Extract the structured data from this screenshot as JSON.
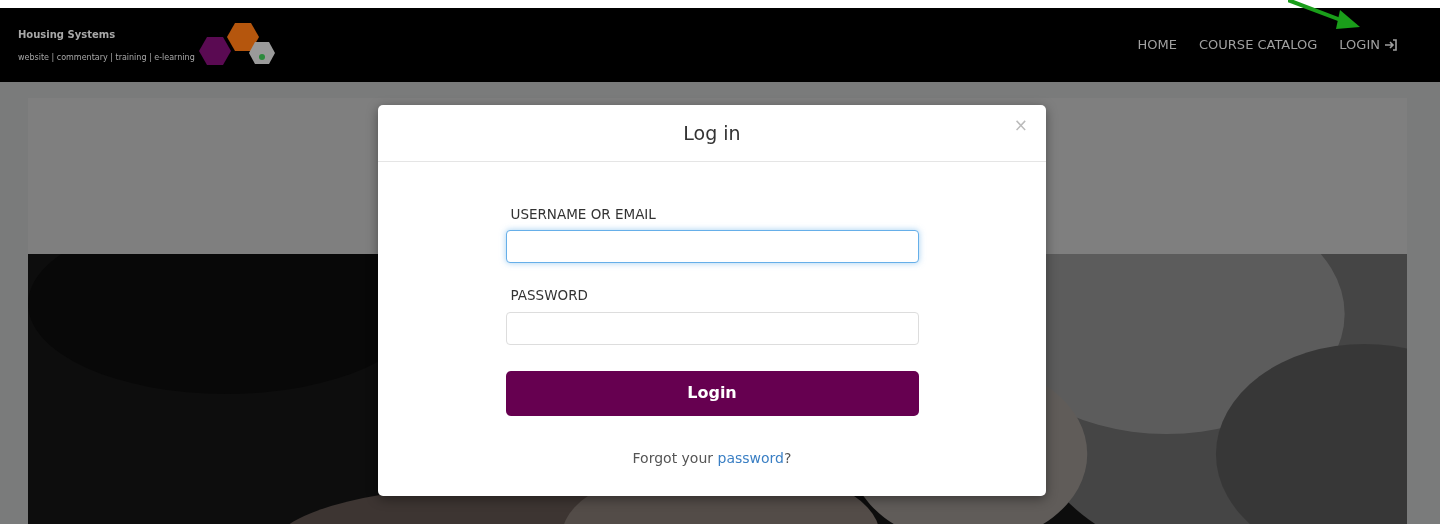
{
  "navbar": {
    "brand": {
      "title": "Housing Systems",
      "tagline": "website | commentary | training | e-learning"
    },
    "links": [
      {
        "label": "HOME",
        "icon": false
      },
      {
        "label": "COURSE CATALOG",
        "icon": false
      },
      {
        "label": "LOGIN",
        "icon": true
      }
    ]
  },
  "modal": {
    "title": "Log in",
    "close": "×",
    "fields": [
      {
        "label": "USERNAME OR EMAIL",
        "focused": true
      },
      {
        "label": "PASSWORD",
        "focused": false
      }
    ],
    "submit": "Login",
    "forgot": {
      "before": "Forgot your ",
      "link": "password",
      "after": "?"
    }
  }
}
